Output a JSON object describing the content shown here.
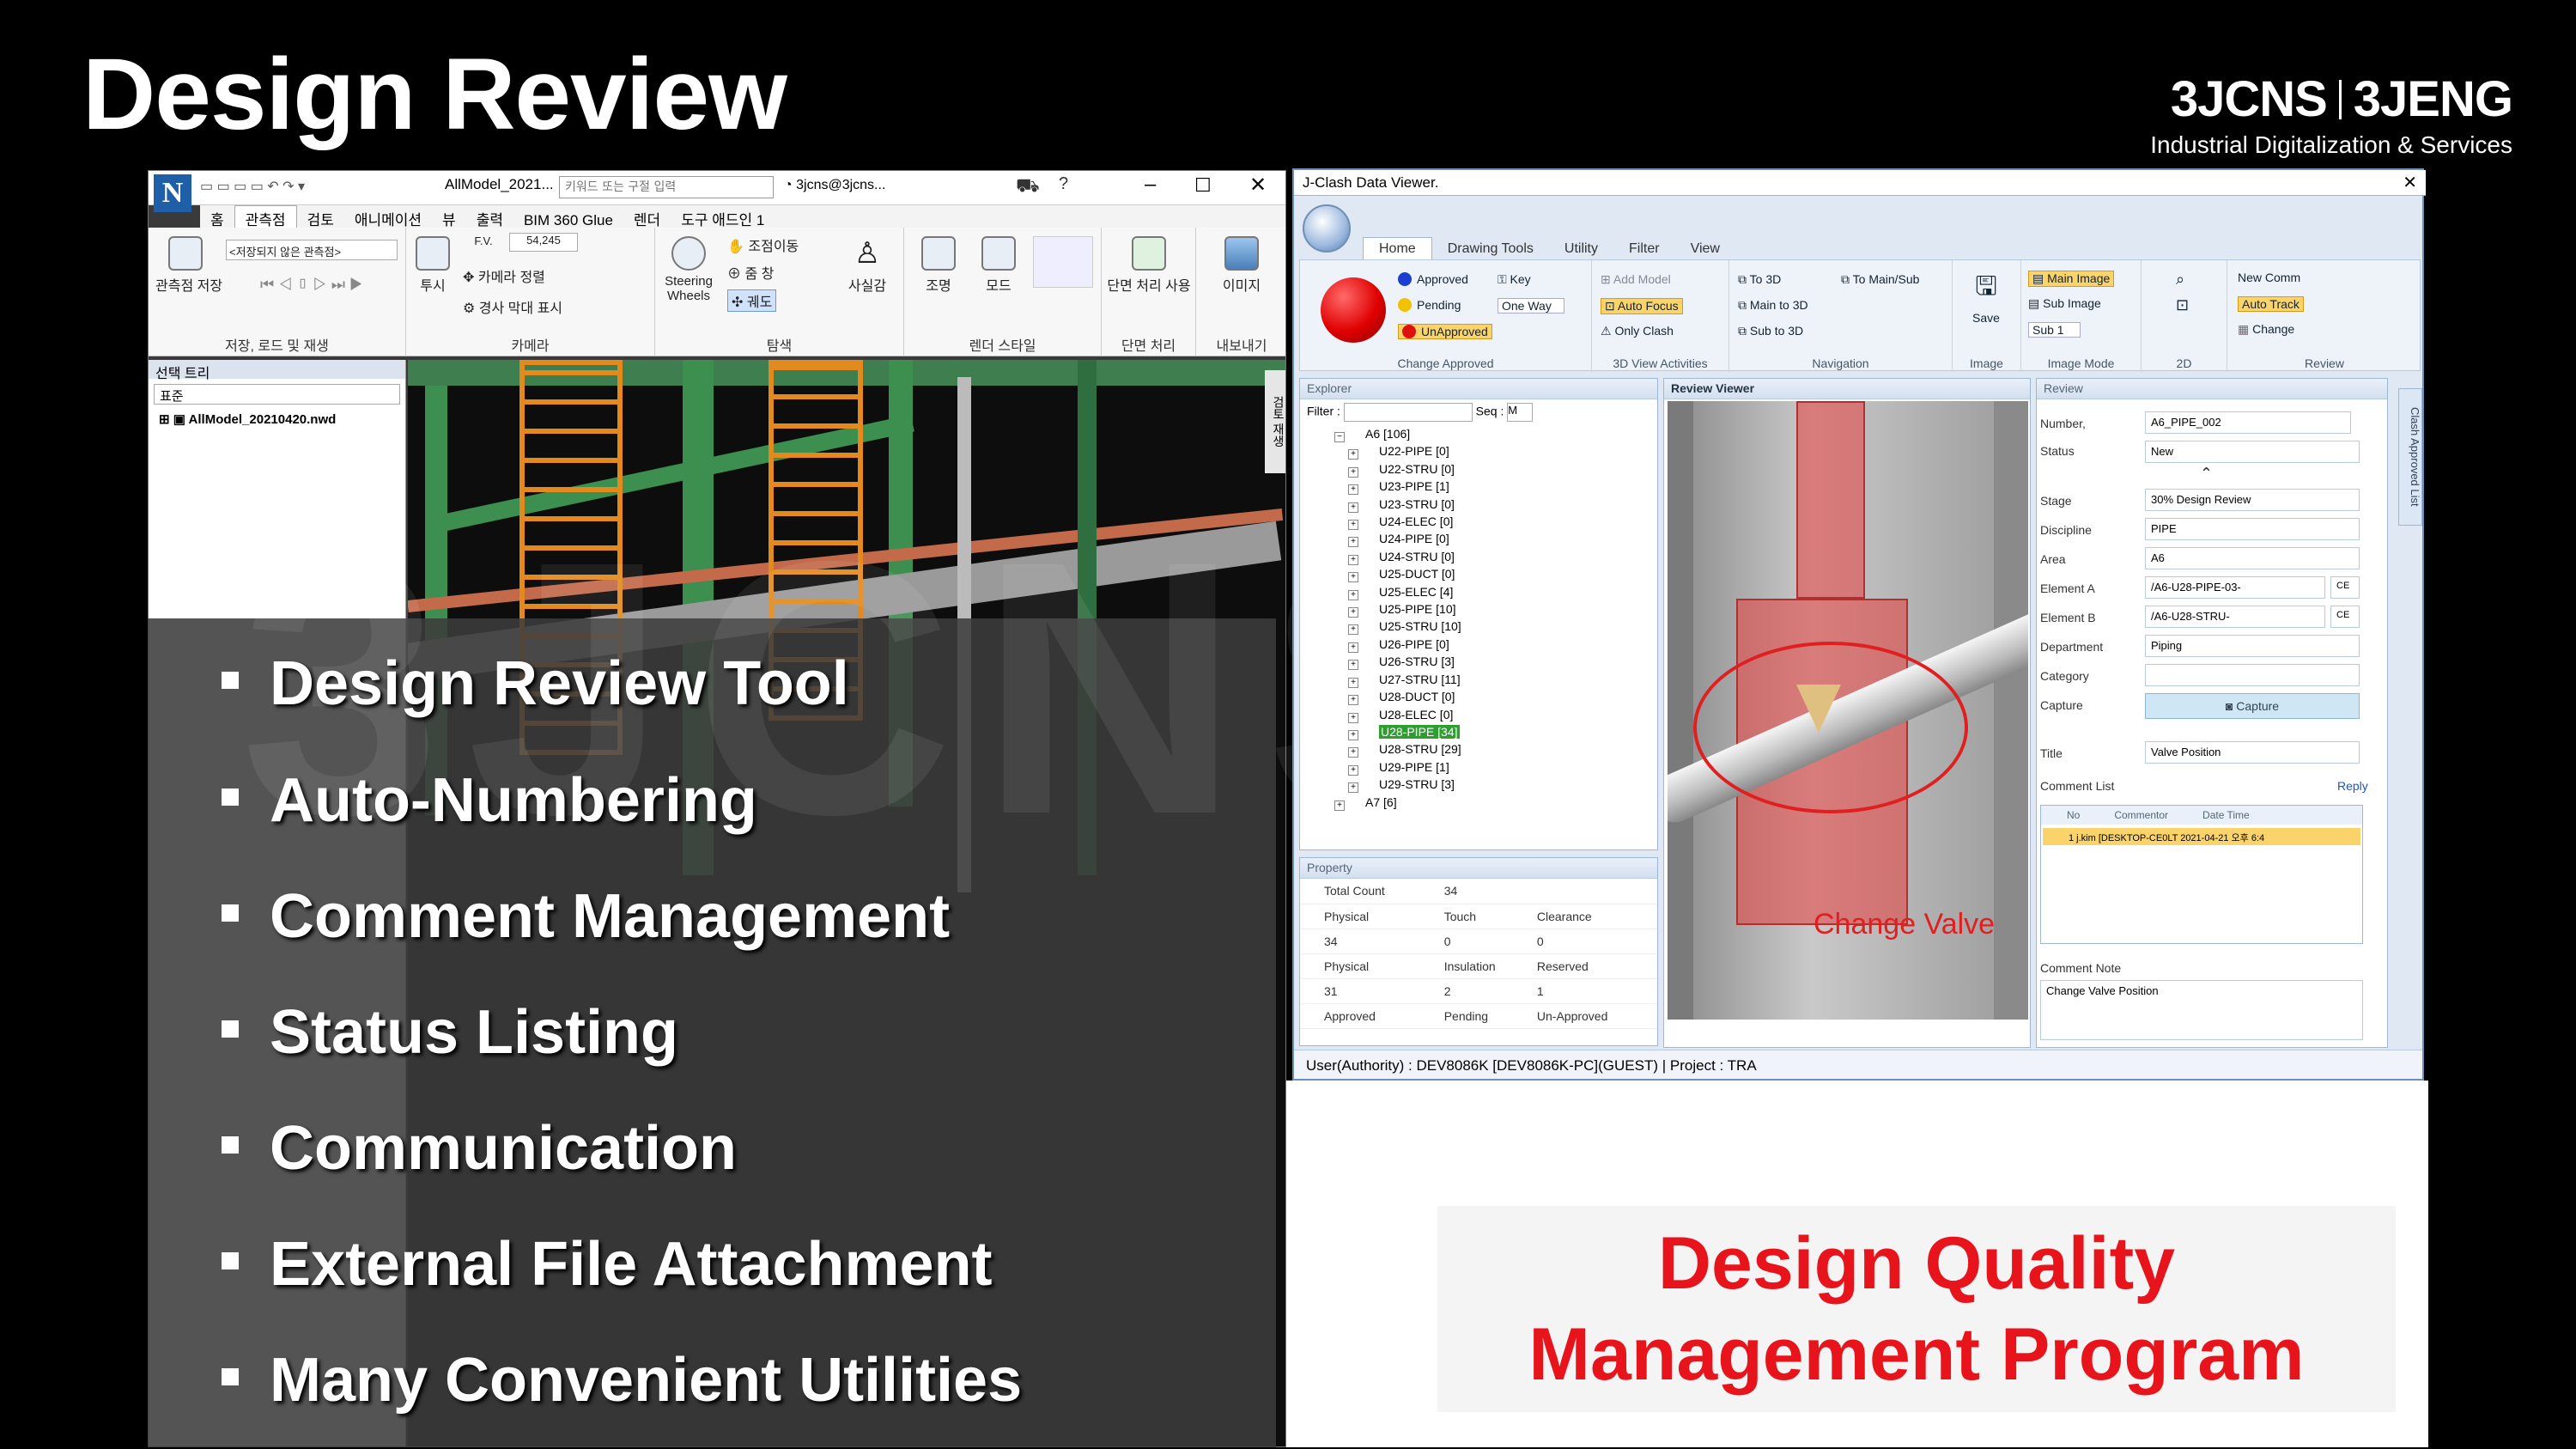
{
  "slide": {
    "title": "Design Review",
    "brand_left": "3JCNS",
    "brand_right": "3JENG",
    "brand_tagline": "Industrial Digitalization & Services",
    "watermark": "3JCNS"
  },
  "bullets": [
    "Design Review Tool",
    "Auto-Numbering",
    "Comment Management",
    "Status Listing",
    "Communication",
    "External File Attachment",
    "Many Convenient Utilities"
  ],
  "callout": {
    "line1": "Design Quality",
    "line2": "Management Program"
  },
  "navisworks": {
    "logo": "N",
    "file_title": "AllModel_2021...",
    "search_placeholder": "키워드 또는 구절 입력",
    "user": "3jcns@3jcns...",
    "tabs": [
      "홈",
      "관측점",
      "검토",
      "애니메이션",
      "뷰",
      "출력",
      "BIM 360 Glue",
      "렌더",
      "도구 애드인 1"
    ],
    "active_tab": 1,
    "ribbon_groups": [
      "저장, 로드 및 재생",
      "카메라",
      "탐색",
      "렌더 스타일",
      "단면 처리",
      "내보내기"
    ],
    "ribbon_buttons": {
      "save_view": "관측점 저장",
      "viewpoint_placeholder": "<저장되지 않은 관측점>",
      "perspective": "투시",
      "fov_label": "F.V.",
      "fov_value": "54,245",
      "align_camera": "카메라 정렬",
      "tilt_bar": "경사 막대 표시",
      "steering": "Steering Wheels",
      "pan": "조점이동",
      "zoom": "줌 창",
      "orbit": "궤도",
      "realism": "사실감",
      "lighting": "조명",
      "mode": "모드",
      "section": "단면 처리 사용",
      "image": "이미지"
    },
    "tree_panel_title": "선택 트리",
    "tree_filter": "표준",
    "tree_item": "AllModel_20210420.nwd",
    "side_tab": "검토 재생"
  },
  "jclash": {
    "window_title": "J-Clash Data Viewer.",
    "tabs": [
      "Home",
      "Drawing Tools",
      "Utility",
      "Filter",
      "View"
    ],
    "ribbon": {
      "status_items": [
        "Approved",
        "Pending",
        "UnApproved"
      ],
      "status_colors": [
        "#1b3fd1",
        "#f2c200",
        "#e01010"
      ],
      "key": "Key",
      "one_way": "One Way",
      "group_change_approved": "Change Approved",
      "add_model": "Add Model",
      "auto_focus": "Auto Focus",
      "only_clash": "Only Clash",
      "group_3d": "3D View Activities",
      "to_3d": "To 3D",
      "main_to_3d": "Main to 3D",
      "sub_to_3d": "Sub to 3D",
      "to_main_sub": "To Main/Sub",
      "group_nav": "Navigation",
      "save": "Save",
      "group_image": "Image",
      "main_image": "Main Image",
      "sub_image": "Sub Image",
      "sub_1": "Sub 1",
      "group_image_mode": "Image Mode",
      "group_2d": "2D",
      "new_comm": "New Comm",
      "auto_track": "Auto Track",
      "change": "Change",
      "group_review": "Review"
    },
    "explorer": {
      "title": "Explorer",
      "filter_label": "Filter :",
      "seq_label": "Seq :",
      "seq_value": "M",
      "items": [
        {
          "label": "A6 [106]",
          "level": 0
        },
        {
          "label": "U22-PIPE [0]",
          "level": 1
        },
        {
          "label": "U22-STRU [0]",
          "level": 1
        },
        {
          "label": "U23-PIPE [1]",
          "level": 1
        },
        {
          "label": "U23-STRU [0]",
          "level": 1
        },
        {
          "label": "U24-ELEC [0]",
          "level": 1
        },
        {
          "label": "U24-PIPE [0]",
          "level": 1
        },
        {
          "label": "U24-STRU [0]",
          "level": 1
        },
        {
          "label": "U25-DUCT [0]",
          "level": 1
        },
        {
          "label": "U25-ELEC [4]",
          "level": 1
        },
        {
          "label": "U25-PIPE [10]",
          "level": 1
        },
        {
          "label": "U25-STRU [10]",
          "level": 1
        },
        {
          "label": "U26-PIPE [0]",
          "level": 1
        },
        {
          "label": "U26-STRU [3]",
          "level": 1
        },
        {
          "label": "U27-STRU [11]",
          "level": 1
        },
        {
          "label": "U28-DUCT [0]",
          "level": 1
        },
        {
          "label": "U28-ELEC [0]",
          "level": 1
        },
        {
          "label": "U28-PIPE [34]",
          "level": 1,
          "selected": true
        },
        {
          "label": "U28-STRU [29]",
          "level": 1
        },
        {
          "label": "U29-PIPE [1]",
          "level": 1
        },
        {
          "label": "U29-STRU [3]",
          "level": 1
        },
        {
          "label": "A7 [6]",
          "level": 0
        }
      ]
    },
    "property": {
      "title": "Property",
      "rows": [
        [
          "Total Count",
          "34",
          ""
        ],
        [
          "Physical",
          "Touch",
          "Clearance"
        ],
        [
          "34",
          "0",
          "0"
        ],
        [
          "Physical",
          "Insulation",
          "Reserved"
        ],
        [
          "31",
          "2",
          "1"
        ],
        [
          "Approved",
          "Pending",
          "Un-Approved"
        ]
      ]
    },
    "viewer": {
      "title": "Review Viewer",
      "annotation": "Change Valve"
    },
    "review": {
      "title": "Review",
      "number_label": "Number,",
      "number_value": "A6_PIPE_002",
      "status_label": "Status",
      "status_value": "New",
      "stage_label": "Stage",
      "stage_value": "30% Design Review",
      "discipline_label": "Discipline",
      "discipline_value": "PIPE",
      "area_label": "Area",
      "area_value": "A6",
      "element_a_label": "Element A",
      "element_a_value": "/A6-U28-PIPE-03-",
      "element_b_label": "Element B",
      "element_b_value": "/A6-U28-STRU-",
      "ce": "CE",
      "department_label": "Department",
      "department_value": "Piping",
      "category_label": "Category",
      "capture_label": "Capture",
      "capture_button": "Capture",
      "title_label": "Title",
      "title_value": "Valve Position",
      "comment_list_label": "Comment List",
      "reply": "Reply",
      "comment_columns": [
        "No",
        "Commentor",
        "Date Time"
      ],
      "comment_row": "1   j.kim [DESKTOP-CE0LT   2021-04-21 오후 6:4",
      "comment_note_label": "Comment Note",
      "comment_note_value": "Change Valve Position"
    },
    "side_tab": "Clash Approved List",
    "status_bar": "User(Authority) : DEV8086K [DEV8086K-PC](GUEST)   |   Project : TRA"
  }
}
